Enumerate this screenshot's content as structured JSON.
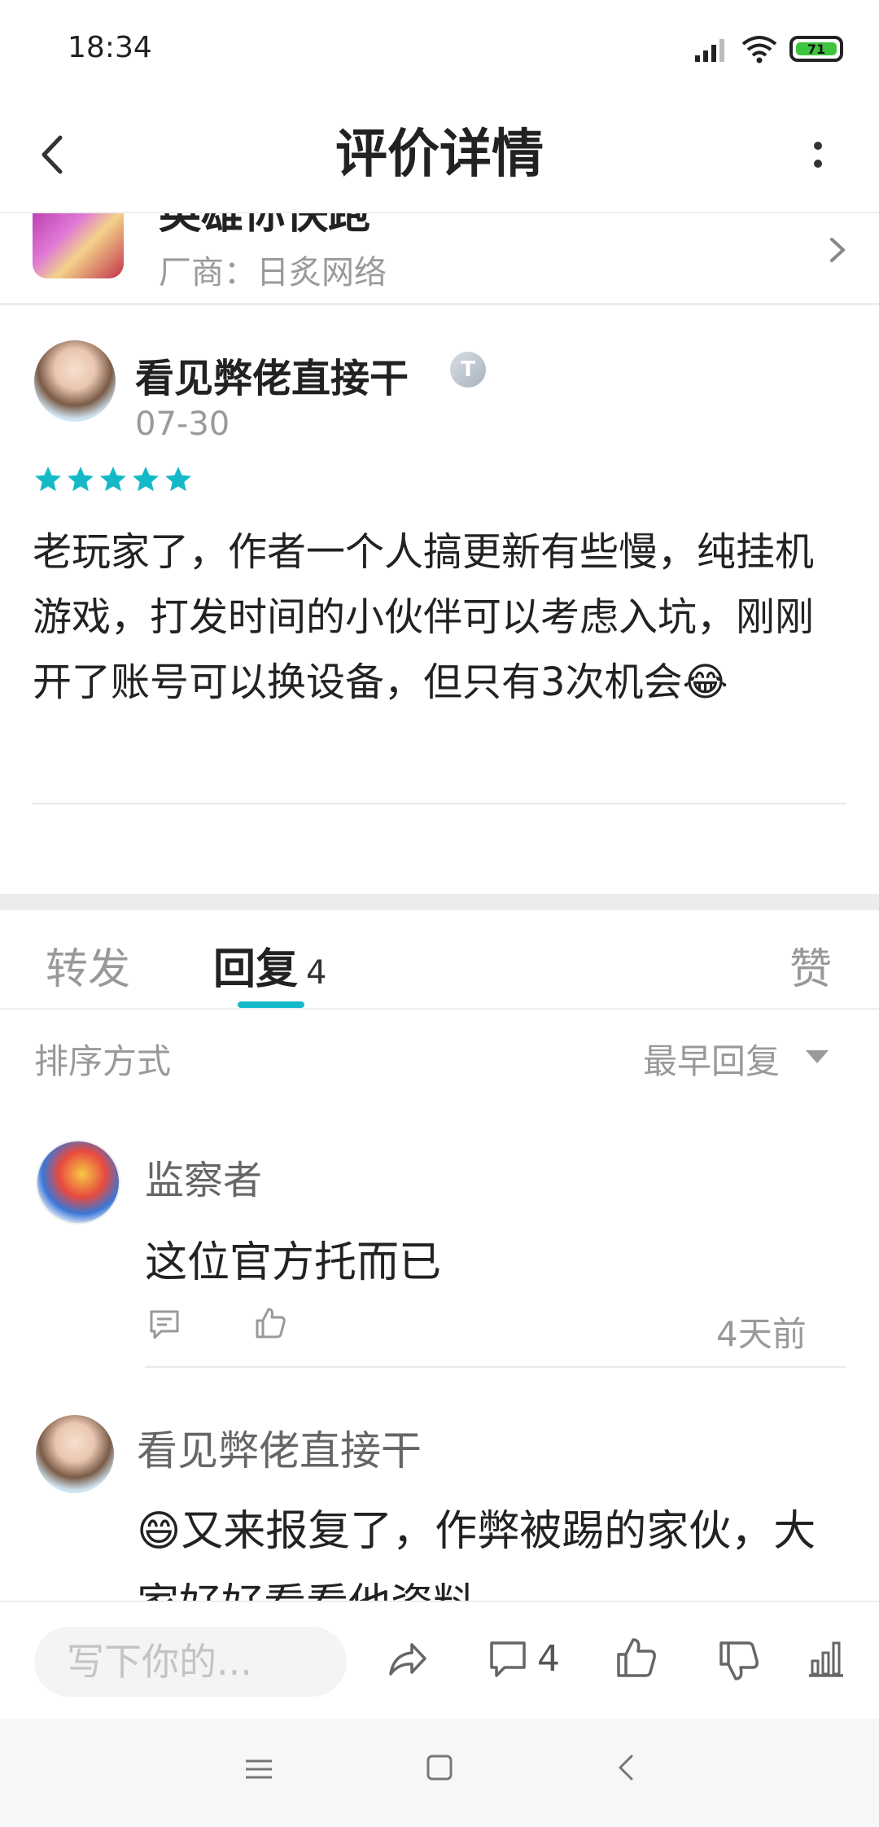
{
  "status_bar": {
    "time": "18:34",
    "battery": "71"
  },
  "header": {
    "title": "评价详情"
  },
  "game": {
    "name": "英雄你快跑",
    "vendor": "厂商：日炙网络"
  },
  "review": {
    "author": "看见弊佬直接干",
    "badge": "T",
    "date": "07-30",
    "rating": 5,
    "body": "老玩家了，作者一个人搞更新有些慢，纯挂机游戏，打发时间的小伙伴可以考虑入坑，刚刚开了账号可以换设备，但只有3次机会😂"
  },
  "tabs": {
    "forward": "转发",
    "reply": "回复",
    "reply_count": "4",
    "like": "赞"
  },
  "sort": {
    "label": "排序方式",
    "selected": "最早回复"
  },
  "comments": [
    {
      "name": "监察者",
      "text": "这位官方托而已",
      "time": "4天前"
    },
    {
      "name": "看见弊佬直接干",
      "text": "😄又来报复了，作弊被踢的家伙，大家好好看看他资料"
    }
  ],
  "action_bar": {
    "input_placeholder": "写下你的...",
    "comment_count": "4"
  },
  "colors": {
    "accent": "#14b9c8",
    "star": "#14b9c8"
  },
  "icons": {
    "back": "chevron-left-icon",
    "more": "more-vertical-icon",
    "share": "share-icon",
    "comment": "comment-icon",
    "like": "thumb-up-icon",
    "dislike": "thumb-down-icon",
    "stats": "bar-chart-icon"
  }
}
